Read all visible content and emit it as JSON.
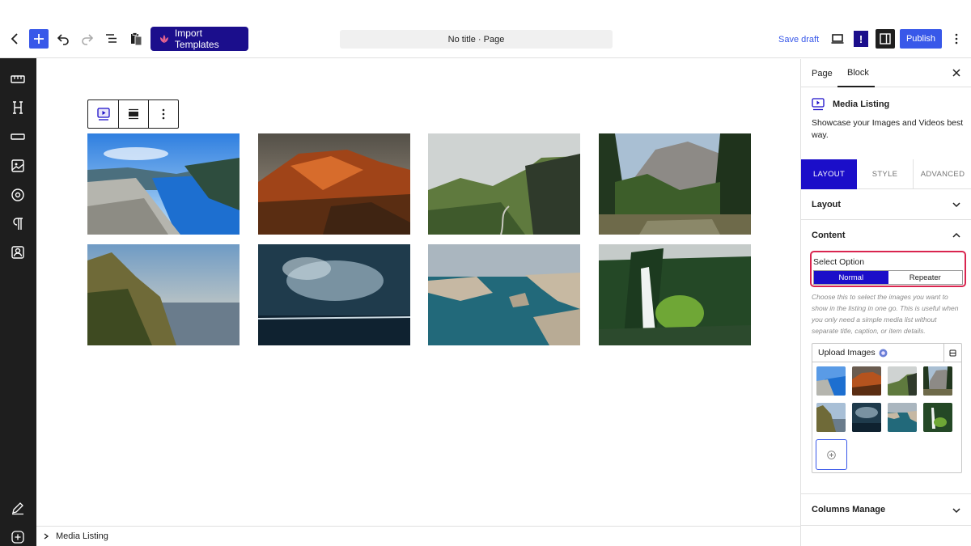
{
  "toolbar": {
    "import_label": "Import Templates",
    "doc_title": "No title · Page",
    "save_draft_label": "Save draft",
    "alert_label": "!",
    "publish_label": "Publish"
  },
  "breadcrumb": {
    "item": "Media Listing"
  },
  "panel": {
    "tabs": [
      "Page",
      "Block"
    ],
    "block_title": "Media Listing",
    "block_description": "Showcase your Images and Videos best way.",
    "layout_tabs": [
      "LAYOUT",
      "STYLE",
      "ADVANCED"
    ],
    "sections": {
      "layout": "Layout",
      "content": "Content",
      "columns": "Columns Manage"
    },
    "select_option": {
      "label": "Select Option",
      "options": [
        "Normal",
        "Repeater"
      ],
      "selected": "Normal"
    },
    "help_text": "Choose this to select the images you want to show in the listing in one go. This is useful when you only need a simple media list without separate title, caption, or item details.",
    "upload_label": "Upload Images"
  },
  "colors": {
    "accent": "#3858e9",
    "brand": "#1b0e8c",
    "active_tab": "#1b0ec9",
    "highlight": "#d9254f"
  },
  "icons": {
    "rail": [
      "ruler-icon",
      "heading-icon",
      "divider-icon",
      "image-icon",
      "circle-target-icon",
      "paragraph-icon",
      "portrait-icon",
      "pencil-icon",
      "plus-circle-icon"
    ]
  }
}
